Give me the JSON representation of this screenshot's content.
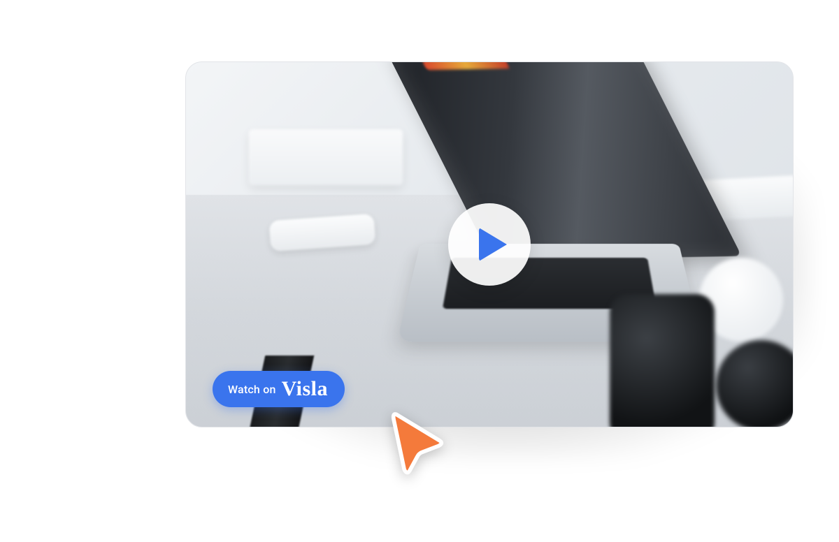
{
  "watch_badge": {
    "prefix": "Watch on",
    "brand": "Visla"
  },
  "icons": {
    "play": "play-icon",
    "cursor": "cursor-pointer-icon"
  },
  "colors": {
    "accent_blue": "#3a74ed",
    "cursor_orange": "#f47a3b"
  }
}
